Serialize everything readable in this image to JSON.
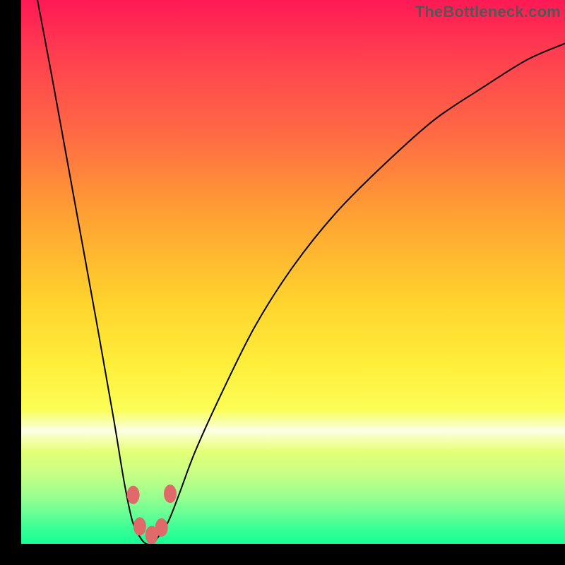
{
  "watermark": "TheBottleneck.com",
  "chart_data": {
    "type": "line",
    "title": "",
    "xlabel": "",
    "ylabel": "",
    "xlim": [
      0,
      100
    ],
    "ylim": [
      0,
      100
    ],
    "grid": false,
    "series": [
      {
        "name": "bottleneck-curve",
        "x": [
          3,
          6,
          10,
          14,
          17,
          19,
          20.5,
          22,
          23,
          24,
          25,
          27,
          29,
          32,
          37,
          43,
          50,
          58,
          67,
          76,
          85,
          93,
          100
        ],
        "y": [
          100,
          84,
          62,
          40,
          23,
          11,
          4,
          1,
          0,
          0,
          1,
          4,
          9,
          17,
          28,
          40,
          51,
          61,
          70,
          78,
          84,
          89,
          92
        ],
        "color": "#000000"
      }
    ],
    "markers": [
      {
        "name": "dot-left-upper",
        "x": 20.6,
        "y": 9.0,
        "color": "#e06a6a"
      },
      {
        "name": "dot-right-upper",
        "x": 27.4,
        "y": 9.2,
        "color": "#e06a6a"
      },
      {
        "name": "dot-left-lower",
        "x": 21.8,
        "y": 3.2,
        "color": "#e06a6a"
      },
      {
        "name": "dot-mid-lower",
        "x": 24.0,
        "y": 1.6,
        "color": "#e06a6a"
      },
      {
        "name": "dot-right-lower",
        "x": 25.8,
        "y": 3.0,
        "color": "#e06a6a"
      }
    ]
  },
  "colors": {
    "frame": "#000000",
    "curve": "#000000",
    "marker": "#e06a6a"
  }
}
